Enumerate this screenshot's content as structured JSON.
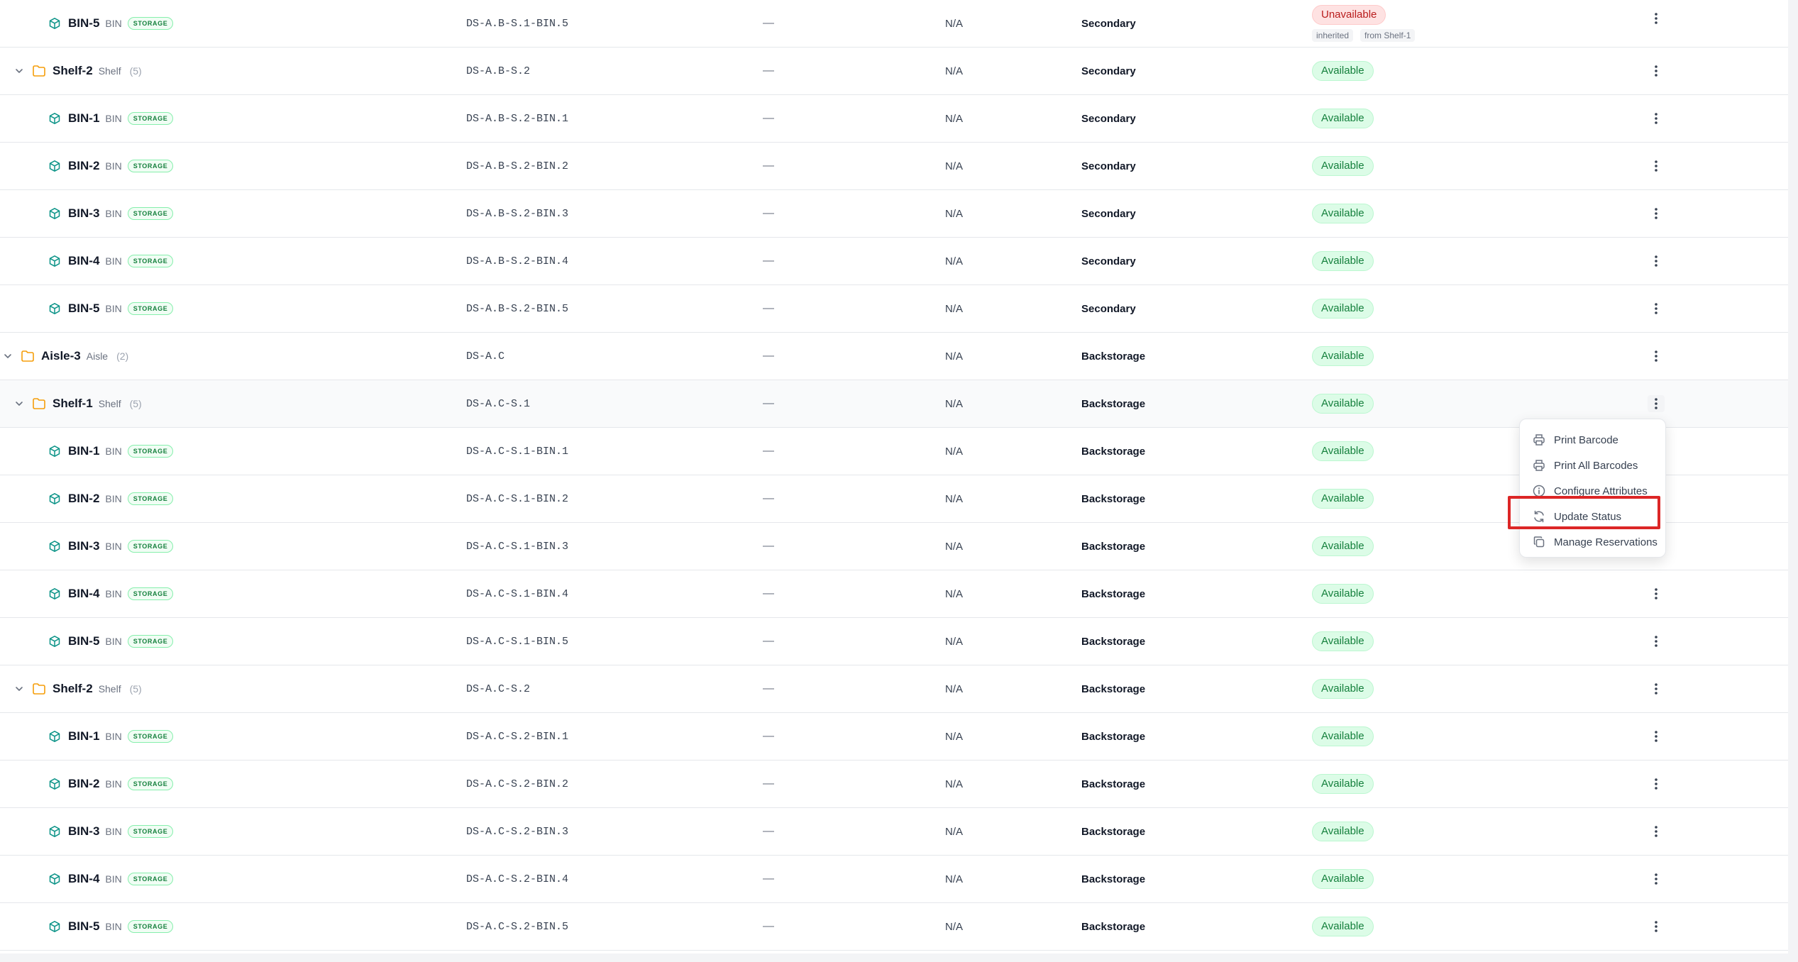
{
  "rows": [
    {
      "kind": "bin",
      "indent": 1,
      "name": "BIN-5",
      "type": "BIN",
      "badge": "STORAGE",
      "code": "DS-A.B-S.1-BIN.5",
      "dash": "—",
      "capacity": "N/A",
      "zone": "Secondary",
      "status": "Unavailable",
      "status_kind": "bad",
      "tags": [
        "inherited",
        "from Shelf-1"
      ]
    },
    {
      "kind": "shelf",
      "indent": 1,
      "name": "Shelf-2",
      "type": "Shelf",
      "count": "(5)",
      "code": "DS-A.B-S.2",
      "dash": "—",
      "capacity": "N/A",
      "zone": "Secondary",
      "status": "Available",
      "status_kind": "ok"
    },
    {
      "kind": "bin",
      "indent": 1,
      "name": "BIN-1",
      "type": "BIN",
      "badge": "STORAGE",
      "code": "DS-A.B-S.2-BIN.1",
      "dash": "—",
      "capacity": "N/A",
      "zone": "Secondary",
      "status": "Available",
      "status_kind": "ok"
    },
    {
      "kind": "bin",
      "indent": 1,
      "name": "BIN-2",
      "type": "BIN",
      "badge": "STORAGE",
      "code": "DS-A.B-S.2-BIN.2",
      "dash": "—",
      "capacity": "N/A",
      "zone": "Secondary",
      "status": "Available",
      "status_kind": "ok"
    },
    {
      "kind": "bin",
      "indent": 1,
      "name": "BIN-3",
      "type": "BIN",
      "badge": "STORAGE",
      "code": "DS-A.B-S.2-BIN.3",
      "dash": "—",
      "capacity": "N/A",
      "zone": "Secondary",
      "status": "Available",
      "status_kind": "ok"
    },
    {
      "kind": "bin",
      "indent": 1,
      "name": "BIN-4",
      "type": "BIN",
      "badge": "STORAGE",
      "code": "DS-A.B-S.2-BIN.4",
      "dash": "—",
      "capacity": "N/A",
      "zone": "Secondary",
      "status": "Available",
      "status_kind": "ok"
    },
    {
      "kind": "bin",
      "indent": 1,
      "name": "BIN-5",
      "type": "BIN",
      "badge": "STORAGE",
      "code": "DS-A.B-S.2-BIN.5",
      "dash": "—",
      "capacity": "N/A",
      "zone": "Secondary",
      "status": "Available",
      "status_kind": "ok"
    },
    {
      "kind": "aisle",
      "indent": 0,
      "name": "Aisle-3",
      "type": "Aisle",
      "count": "(2)",
      "code": "DS-A.C",
      "dash": "—",
      "capacity": "N/A",
      "zone": "Backstorage",
      "status": "Available",
      "status_kind": "ok"
    },
    {
      "kind": "shelf",
      "indent": 1,
      "name": "Shelf-1",
      "type": "Shelf",
      "count": "(5)",
      "code": "DS-A.C-S.1",
      "dash": "—",
      "capacity": "N/A",
      "zone": "Backstorage",
      "status": "Available",
      "status_kind": "ok",
      "highlighted": true,
      "menu_open": true
    },
    {
      "kind": "bin",
      "indent": 1,
      "name": "BIN-1",
      "type": "BIN",
      "badge": "STORAGE",
      "code": "DS-A.C-S.1-BIN.1",
      "dash": "—",
      "capacity": "N/A",
      "zone": "Backstorage",
      "status": "Available",
      "status_kind": "ok",
      "hide_kebab": true
    },
    {
      "kind": "bin",
      "indent": 1,
      "name": "BIN-2",
      "type": "BIN",
      "badge": "STORAGE",
      "code": "DS-A.C-S.1-BIN.2",
      "dash": "—",
      "capacity": "N/A",
      "zone": "Backstorage",
      "status": "Available",
      "status_kind": "ok",
      "hide_kebab": true
    },
    {
      "kind": "bin",
      "indent": 1,
      "name": "BIN-3",
      "type": "BIN",
      "badge": "STORAGE",
      "code": "DS-A.C-S.1-BIN.3",
      "dash": "—",
      "capacity": "N/A",
      "zone": "Backstorage",
      "status": "Available",
      "status_kind": "ok",
      "hide_kebab": true
    },
    {
      "kind": "bin",
      "indent": 1,
      "name": "BIN-4",
      "type": "BIN",
      "badge": "STORAGE",
      "code": "DS-A.C-S.1-BIN.4",
      "dash": "—",
      "capacity": "N/A",
      "zone": "Backstorage",
      "status": "Available",
      "status_kind": "ok"
    },
    {
      "kind": "bin",
      "indent": 1,
      "name": "BIN-5",
      "type": "BIN",
      "badge": "STORAGE",
      "code": "DS-A.C-S.1-BIN.5",
      "dash": "—",
      "capacity": "N/A",
      "zone": "Backstorage",
      "status": "Available",
      "status_kind": "ok"
    },
    {
      "kind": "shelf",
      "indent": 1,
      "name": "Shelf-2",
      "type": "Shelf",
      "count": "(5)",
      "code": "DS-A.C-S.2",
      "dash": "—",
      "capacity": "N/A",
      "zone": "Backstorage",
      "status": "Available",
      "status_kind": "ok"
    },
    {
      "kind": "bin",
      "indent": 1,
      "name": "BIN-1",
      "type": "BIN",
      "badge": "STORAGE",
      "code": "DS-A.C-S.2-BIN.1",
      "dash": "—",
      "capacity": "N/A",
      "zone": "Backstorage",
      "status": "Available",
      "status_kind": "ok"
    },
    {
      "kind": "bin",
      "indent": 1,
      "name": "BIN-2",
      "type": "BIN",
      "badge": "STORAGE",
      "code": "DS-A.C-S.2-BIN.2",
      "dash": "—",
      "capacity": "N/A",
      "zone": "Backstorage",
      "status": "Available",
      "status_kind": "ok"
    },
    {
      "kind": "bin",
      "indent": 1,
      "name": "BIN-3",
      "type": "BIN",
      "badge": "STORAGE",
      "code": "DS-A.C-S.2-BIN.3",
      "dash": "—",
      "capacity": "N/A",
      "zone": "Backstorage",
      "status": "Available",
      "status_kind": "ok"
    },
    {
      "kind": "bin",
      "indent": 1,
      "name": "BIN-4",
      "type": "BIN",
      "badge": "STORAGE",
      "code": "DS-A.C-S.2-BIN.4",
      "dash": "—",
      "capacity": "N/A",
      "zone": "Backstorage",
      "status": "Available",
      "status_kind": "ok"
    },
    {
      "kind": "bin",
      "indent": 1,
      "name": "BIN-5",
      "type": "BIN",
      "badge": "STORAGE",
      "code": "DS-A.C-S.2-BIN.5",
      "dash": "—",
      "capacity": "N/A",
      "zone": "Backstorage",
      "status": "Available",
      "status_kind": "ok"
    }
  ],
  "menu": {
    "items": [
      {
        "label": "Print Barcode",
        "icon": "printer-icon"
      },
      {
        "label": "Print All Barcodes",
        "icon": "printer-icon"
      },
      {
        "label": "Configure Attributes",
        "icon": "info-icon"
      },
      {
        "label": "Update Status",
        "icon": "refresh-icon",
        "highlighted": true
      },
      {
        "label": "Manage Reservations",
        "icon": "copy-icon"
      }
    ]
  },
  "colors": {
    "accent_teal": "#0d9488",
    "folder": "#f59e0b",
    "highlight_box": "#dc2626"
  }
}
